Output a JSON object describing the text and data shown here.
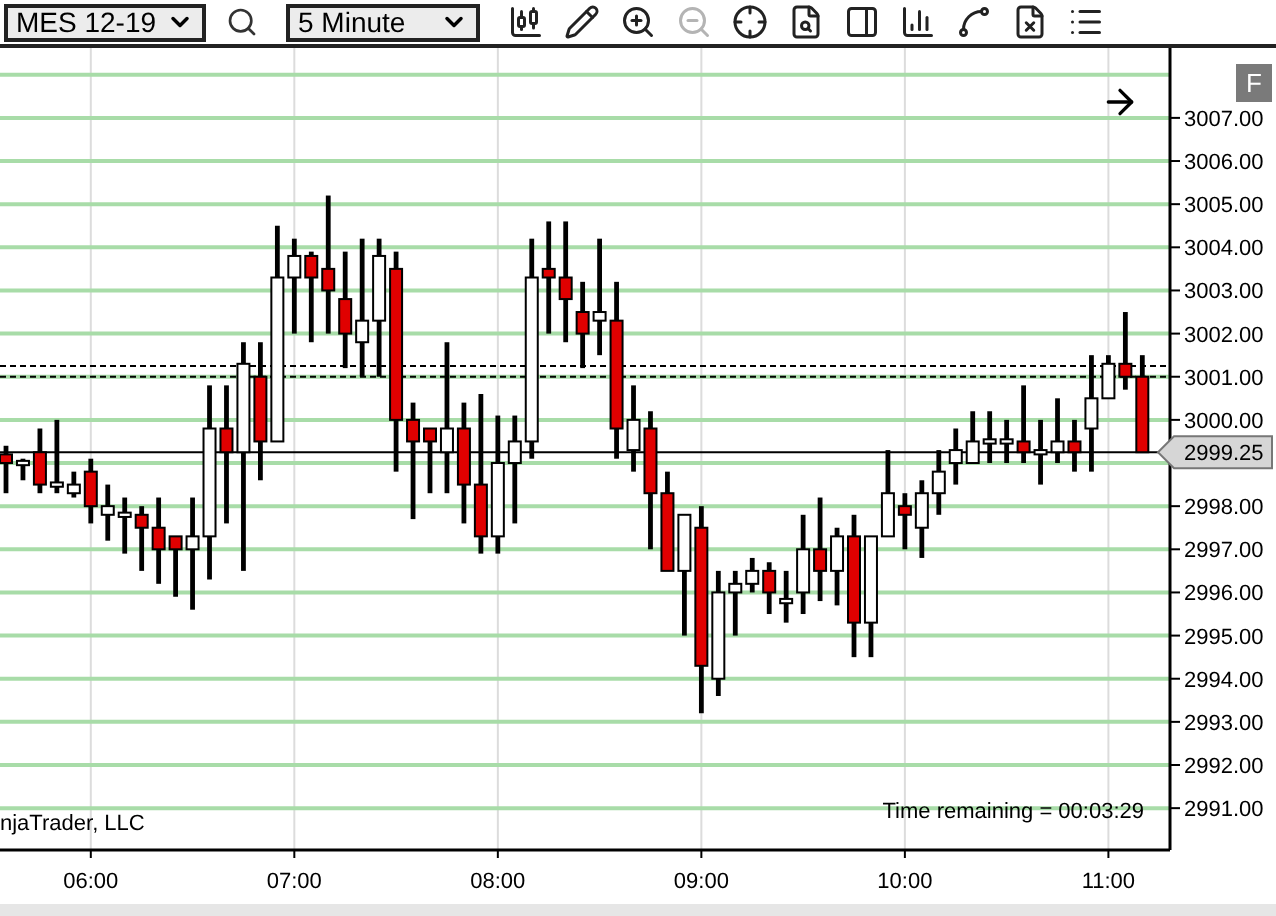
{
  "toolbar": {
    "instrument": "MES 12-19",
    "interval": "5 Minute",
    "tools": [
      {
        "kind": "bars",
        "disabled": false
      },
      {
        "kind": "pencil",
        "disabled": false
      },
      {
        "kind": "zoom-in",
        "disabled": false
      },
      {
        "kind": "zoom-out",
        "disabled": true
      },
      {
        "kind": "crosshair",
        "disabled": false
      },
      {
        "kind": "document",
        "disabled": false
      },
      {
        "kind": "panel",
        "disabled": false
      },
      {
        "kind": "columns",
        "disabled": false
      },
      {
        "kind": "nodes",
        "disabled": false
      },
      {
        "kind": "strategy",
        "disabled": false
      },
      {
        "kind": "list",
        "disabled": false
      }
    ]
  },
  "chart": {
    "panel_button": "F",
    "current_price": "2999.25",
    "copyright": "njaTrader, LLC",
    "time_remaining": "Time remaining = 00:03:29",
    "chart_data": {
      "type": "candlestick",
      "categories": [
        null,
        null,
        null,
        null,
        null,
        "06:00",
        null,
        null,
        null,
        null,
        null,
        null,
        null,
        null,
        null,
        null,
        null,
        "07:00",
        null,
        null,
        null,
        null,
        null,
        null,
        null,
        null,
        null,
        null,
        null,
        "08:00",
        null,
        null,
        null,
        null,
        null,
        null,
        null,
        null,
        null,
        null,
        null,
        "09:00",
        null,
        null,
        null,
        null,
        null,
        null,
        null,
        null,
        null,
        null,
        null,
        "10:00",
        null,
        null,
        null,
        null,
        null,
        null,
        null,
        null,
        null,
        null,
        null,
        "11:00",
        null,
        null
      ],
      "ylim": [
        2990.03,
        3008.62
      ],
      "grid": true,
      "ref_lines": [
        {
          "axis": "y",
          "value": 3001.25
        },
        {
          "axis": "y",
          "value": 3001.0
        },
        {
          "axis": "y",
          "value": 2999.25
        }
      ],
      "ohlc": [
        [
          2999.2,
          2999.4,
          2998.3,
          2999.0
        ],
        [
          2998.95,
          2999.1,
          2998.6,
          2999.05
        ],
        [
          2999.25,
          2999.8,
          2998.3,
          2998.5
        ],
        [
          2998.45,
          3000.0,
          2998.3,
          2998.55
        ],
        [
          2998.3,
          2998.8,
          2998.2,
          2998.5
        ],
        [
          2998.8,
          2999.1,
          2997.6,
          2998.0
        ],
        [
          2997.8,
          2998.5,
          2997.2,
          2998.0
        ],
        [
          2997.75,
          2998.2,
          2996.9,
          2997.85
        ],
        [
          2997.8,
          2998.0,
          2996.5,
          2997.5
        ],
        [
          2997.5,
          2998.2,
          2996.2,
          2997.0
        ],
        [
          2997.3,
          2997.3,
          2995.9,
          2997.0
        ],
        [
          2997.0,
          2998.2,
          2995.6,
          2997.3
        ],
        [
          2997.3,
          3000.8,
          2996.3,
          2999.8
        ],
        [
          2999.8,
          3000.8,
          2997.6,
          2999.25
        ],
        [
          2999.25,
          3001.8,
          2996.5,
          3001.3
        ],
        [
          3001.0,
          3001.8,
          2998.6,
          2999.5
        ],
        [
          2999.5,
          3004.5,
          2999.5,
          3003.3
        ],
        [
          3003.3,
          3004.2,
          3002.0,
          3003.8
        ],
        [
          3003.8,
          3003.9,
          3001.8,
          3003.3
        ],
        [
          3003.5,
          3005.2,
          3002.0,
          3003.0
        ],
        [
          3002.8,
          3003.9,
          3001.2,
          3002.0
        ],
        [
          3001.8,
          3004.2,
          3001.0,
          3002.3
        ],
        [
          3002.3,
          3004.2,
          3001.0,
          3003.8
        ],
        [
          3003.5,
          3003.9,
          2998.8,
          3000.0
        ],
        [
          3000.0,
          3000.4,
          2997.7,
          2999.5
        ],
        [
          2999.8,
          2999.8,
          2998.3,
          2999.5
        ],
        [
          2999.25,
          3001.8,
          2998.3,
          2999.8
        ],
        [
          2999.8,
          3000.4,
          2997.6,
          2998.5
        ],
        [
          2998.5,
          3000.6,
          2996.9,
          2997.3
        ],
        [
          2997.3,
          3000.1,
          2996.9,
          2999.0
        ],
        [
          2999.0,
          3000.1,
          2997.6,
          2999.5
        ],
        [
          2999.5,
          3004.2,
          2999.1,
          3003.3
        ],
        [
          3003.5,
          3004.6,
          3002.0,
          3003.3
        ],
        [
          3003.3,
          3004.6,
          3001.8,
          3002.8
        ],
        [
          3002.5,
          3003.2,
          3001.2,
          3002.0
        ],
        [
          3002.3,
          3004.2,
          3001.5,
          3002.5
        ],
        [
          3002.3,
          3003.2,
          2999.1,
          2999.8
        ],
        [
          2999.3,
          3000.8,
          2998.8,
          3000.0
        ],
        [
          2999.8,
          3000.2,
          2997.0,
          2998.3
        ],
        [
          2998.3,
          2998.8,
          2996.5,
          2996.5
        ],
        [
          2996.5,
          2997.8,
          2995.0,
          2997.8
        ],
        [
          2997.5,
          2998.0,
          2993.2,
          2994.3
        ],
        [
          2994.0,
          2996.5,
          2993.6,
          2996.0
        ],
        [
          2996.0,
          2996.5,
          2995.0,
          2996.2
        ],
        [
          2996.2,
          2996.8,
          2996.0,
          2996.5
        ],
        [
          2996.5,
          2996.7,
          2995.5,
          2996.0
        ],
        [
          2995.75,
          2996.5,
          2995.3,
          2995.85
        ],
        [
          2996.0,
          2997.8,
          2995.5,
          2997.0
        ],
        [
          2997.0,
          2998.2,
          2995.8,
          2996.5
        ],
        [
          2996.5,
          2997.5,
          2995.7,
          2997.3
        ],
        [
          2997.3,
          2997.8,
          2994.5,
          2995.3
        ],
        [
          2995.3,
          2997.3,
          2994.5,
          2997.3
        ],
        [
          2997.3,
          2999.3,
          2997.3,
          2998.3
        ],
        [
          2998.0,
          2998.3,
          2997.0,
          2997.8
        ],
        [
          2997.5,
          2998.6,
          2996.8,
          2998.3
        ],
        [
          2998.3,
          2999.3,
          2997.8,
          2998.8
        ],
        [
          2999.0,
          2999.8,
          2998.5,
          2999.3
        ],
        [
          2999.0,
          3000.2,
          2999.0,
          2999.5
        ],
        [
          2999.45,
          3000.2,
          2999.0,
          2999.55
        ],
        [
          2999.45,
          3000.0,
          2999.0,
          2999.55
        ],
        [
          2999.5,
          3000.8,
          2999.0,
          2999.25
        ],
        [
          2999.2,
          3000.0,
          2998.5,
          2999.3
        ],
        [
          2999.25,
          3000.5,
          2999.0,
          2999.5
        ],
        [
          2999.5,
          3000.0,
          2998.8,
          2999.25
        ],
        [
          2999.8,
          3001.5,
          2998.8,
          3000.5
        ],
        [
          3000.5,
          3001.5,
          3000.5,
          3001.3
        ],
        [
          3001.3,
          3002.5,
          3000.7,
          3001.0
        ],
        [
          3001.0,
          3001.5,
          2999.25,
          2999.25
        ]
      ],
      "yticks": [
        {
          "value": 3007,
          "label": "3007.00"
        },
        {
          "value": 3006,
          "label": "3006.00"
        },
        {
          "value": 3005,
          "label": "3005.00"
        },
        {
          "value": 3004,
          "label": "3004.00"
        },
        {
          "value": 3003,
          "label": "3003.00"
        },
        {
          "value": 3002,
          "label": "3002.00"
        },
        {
          "value": 3001,
          "label": "3001.00"
        },
        {
          "value": 3000,
          "label": "3000.00"
        },
        {
          "value": 2998,
          "label": "2998.00"
        },
        {
          "value": 2997,
          "label": "2997.00"
        },
        {
          "value": 2996,
          "label": "2996.00"
        },
        {
          "value": 2995,
          "label": "2995.00"
        },
        {
          "value": 2994,
          "label": "2994.00"
        },
        {
          "value": 2993,
          "label": "2993.00"
        },
        {
          "value": 2992,
          "label": "2992.00"
        },
        {
          "value": 2991,
          "label": "2991.00"
        }
      ]
    }
  }
}
